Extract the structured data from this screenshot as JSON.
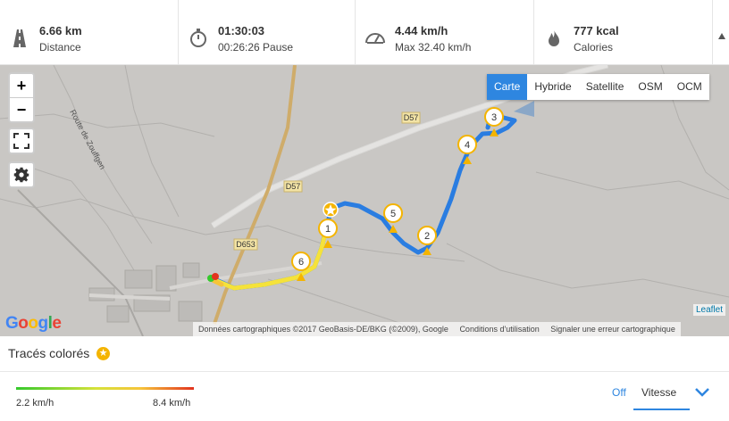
{
  "stats": [
    {
      "icon": "road-icon",
      "value": "6.66 km",
      "label": "Distance"
    },
    {
      "icon": "stopwatch-icon",
      "value": "01:30:03",
      "label": "00:26:26 Pause"
    },
    {
      "icon": "speedometer-icon",
      "value": "4.44 km/h",
      "label": "Max 32.40 km/h"
    },
    {
      "icon": "flame-icon",
      "value": "777 kcal",
      "label": "Calories"
    }
  ],
  "map": {
    "layers": [
      "Carte",
      "Hybride",
      "Satellite",
      "OSM",
      "OCM"
    ],
    "active_layer": "Carte",
    "zoom_in": "+",
    "zoom_out": "−",
    "roads": {
      "d57_a": "D57",
      "d57_b": "D57",
      "d653": "D653",
      "route_zouffgen": "Route de Zouffgen"
    },
    "markers": [
      "1",
      "2",
      "3",
      "4",
      "5",
      "6"
    ],
    "google_logo": "Google",
    "attribution": [
      "Données cartographiques ©2017 GeoBasis-DE/BKG (©2009), Google",
      "Conditions d'utilisation",
      "Signaler une erreur cartographique"
    ],
    "leaflet": "Leaflet"
  },
  "colored_traces": {
    "title": "Tracés colorés",
    "min": "2.2 km/h",
    "max": "8.4 km/h",
    "off_label": "Off",
    "selected": "Vitesse"
  },
  "colors": {
    "accent": "#2e86e0",
    "route_blue": "#2a7de1",
    "route_yellow": "#f5e23a",
    "marker": "#f4b400"
  }
}
